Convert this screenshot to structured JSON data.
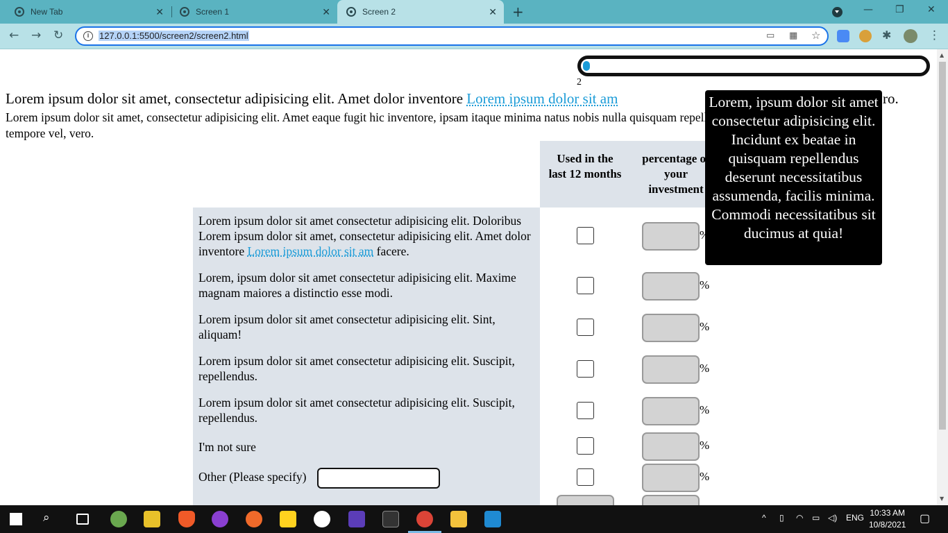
{
  "browser": {
    "tabs": [
      {
        "label": "New Tab"
      },
      {
        "label": "Screen 1"
      },
      {
        "label": "Screen 2"
      }
    ],
    "url": "127.0.0.1:5500/screen2/screen2.html"
  },
  "page": {
    "progress": {
      "value_percent": 2,
      "label": "2"
    },
    "intro_line": "Lorem ipsum dolor sit amet, consectetur adipisicing elit. Amet dolor inventore",
    "intro_link": "Lorem ipsum dolor sit am",
    "intro_tail": "ro.",
    "intro_paragraph": "Lorem ipsum dolor sit amet, consectetur adipisicing elit. Amet eaque fugit hic inventore, ipsam itaque minima natus nobis nulla quisquam repellendus tempore vel, vero.",
    "headers": {
      "used": "Used in the last 12 months",
      "percentage": "percentage of your investment"
    },
    "rows": [
      {
        "text": "Lorem ipsum dolor sit amet consectetur adipisicing elit. Doloribus Lorem ipsum dolor sit amet, consectetur adipisicing elit. Amet dolor inventore",
        "link": "Lorem ipsum dolor sit am",
        "after_link": " facere.",
        "pct": "%"
      },
      {
        "text": "Lorem, ipsum dolor sit amet consectetur adipisicing elit. Maxime magnam maiores a distinctio esse modi.",
        "pct": "%"
      },
      {
        "text": "Lorem ipsum dolor sit amet consectetur adipisicing elit. Sint, aliquam!",
        "pct": "%"
      },
      {
        "text": "Lorem ipsum dolor sit amet consectetur adipisicing elit. Suscipit, repellendus.",
        "pct": "%"
      },
      {
        "text": "Lorem ipsum dolor sit amet consectetur adipisicing elit. Suscipit, repellendus.",
        "pct": "%"
      },
      {
        "text": "I'm not sure",
        "pct": "%"
      },
      {
        "text": "Other (Please specify)",
        "pct": "%"
      }
    ],
    "tooltip": "Lorem, ipsum dolor sit amet consectetur adipisicing elit. Incidunt ex beatae in quisquam repellendus deserunt necessitatibus assumenda, facilis minima. Commodi necessitatibus sit ducimus at quia!"
  },
  "taskbar": {
    "language": "ENG",
    "time": "10:33 AM",
    "date": "10/8/2021"
  },
  "colors": {
    "accent": "#1a9bd7",
    "tabbar": "#5ab3c1",
    "toolbar": "#b8e1e7",
    "panel": "#dde3ea"
  }
}
